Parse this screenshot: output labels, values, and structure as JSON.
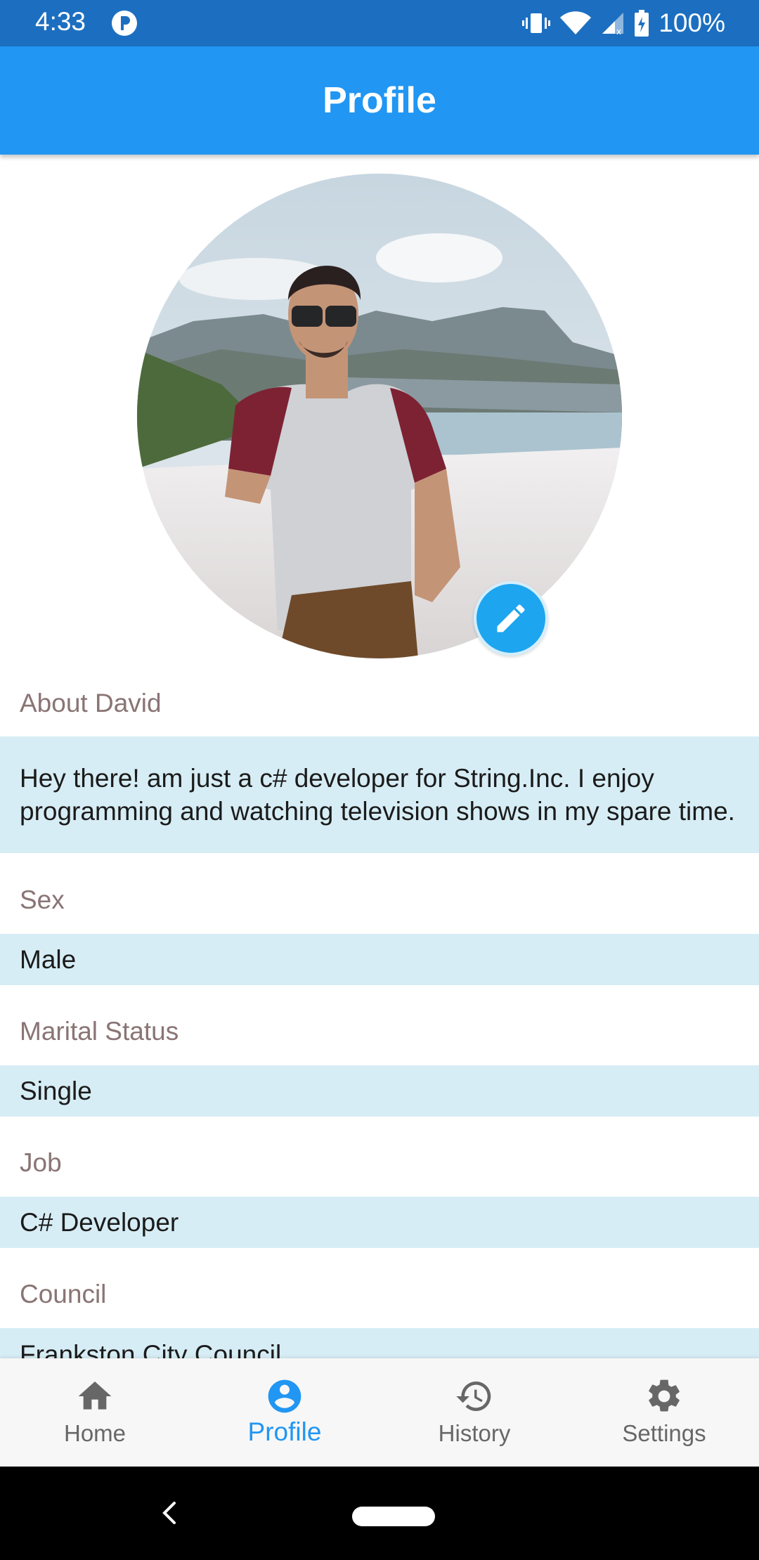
{
  "status_bar": {
    "time": "4:33",
    "battery": "100%",
    "icons": [
      "app-notification-icon",
      "vibrate-icon",
      "wifi-icon",
      "cell-signal-icon",
      "battery-charging-icon"
    ]
  },
  "app_bar": {
    "title": "Profile"
  },
  "profile": {
    "avatar_icon": "profile-photo",
    "edit_icon": "pencil-icon",
    "fields": [
      {
        "label": "About David",
        "value": "Hey there! am just a c# developer for String.Inc. I enjoy programming and watching television shows in my spare time."
      },
      {
        "label": "Sex",
        "value": "Male"
      },
      {
        "label": "Marital Status",
        "value": "Single"
      },
      {
        "label": "Job",
        "value": "C# Developer"
      },
      {
        "label": "Council",
        "value": "Frankston City Council"
      }
    ]
  },
  "bottom_nav": {
    "items": [
      {
        "label": "Home",
        "icon": "home-icon",
        "active": false
      },
      {
        "label": "Profile",
        "icon": "account-circle-icon",
        "active": true
      },
      {
        "label": "History",
        "icon": "history-icon",
        "active": false
      },
      {
        "label": "Settings",
        "icon": "gear-icon",
        "active": false
      }
    ]
  },
  "colors": {
    "status_bar": "#1c6fc0",
    "app_bar": "#2196f3",
    "field_value_bg": "#d7edf5",
    "field_label": "#8a7474",
    "nav_active": "#2196f3",
    "nav_inactive": "#676767",
    "edit_button": "#1ea5ef"
  }
}
